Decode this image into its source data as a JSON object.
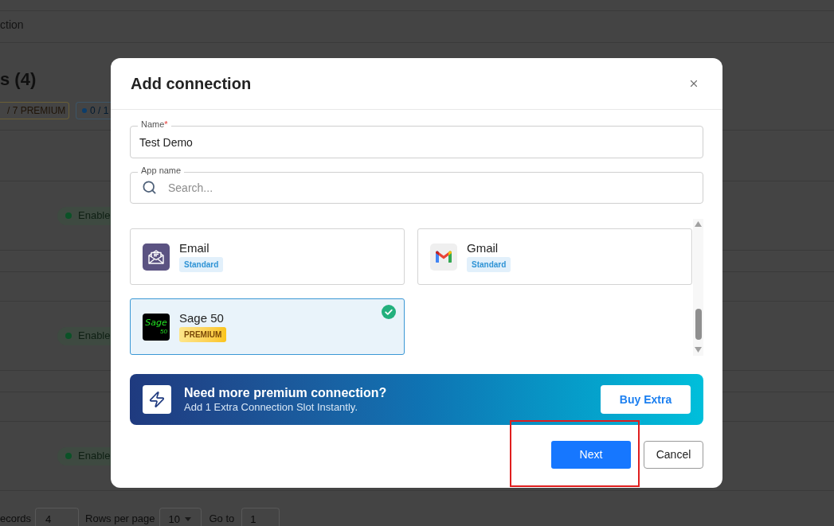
{
  "page": {
    "breadcrumb": "ction",
    "title": "s (4)",
    "badges": [
      {
        "kind": "premium",
        "text": "/ 7 PREMIUM"
      },
      {
        "kind": "count",
        "text": "0 / 1"
      }
    ],
    "rows": [
      {
        "status": "Enable"
      },
      {
        "status": "Enable"
      },
      {
        "status": "Enable"
      }
    ],
    "pagination": {
      "records_label": "ecords",
      "records": "4",
      "rows_per_page_label": "Rows per page",
      "rows_per_page": "10",
      "go_to_label": "Go to",
      "go_to": "1"
    }
  },
  "dialog": {
    "title": "Add connection",
    "fields": [
      {
        "kind": "text",
        "label": "Name",
        "required_mark": "*",
        "value": "Test Demo"
      },
      {
        "kind": "search",
        "label": "App name",
        "placeholder": "Search..."
      }
    ],
    "apps": [
      {
        "name": "Email",
        "tier": "Standard",
        "kind": "standard",
        "selected": false
      },
      {
        "name": "Gmail",
        "tier": "Standard",
        "kind": "standard",
        "selected": false
      },
      {
        "name": "Sage 50",
        "tier": "PREMIUM",
        "kind": "premium",
        "selected": true,
        "logo": {
          "text": "Sage",
          "subtext": "50"
        }
      }
    ],
    "banner": {
      "title": "Need more premium connection?",
      "subtitle": "Add 1 Extra Connection Slot Instantly.",
      "button": "Buy Extra"
    },
    "buttons": [
      {
        "label": "Next",
        "kind": "primary"
      },
      {
        "label": "Cancel",
        "kind": "secondary"
      }
    ]
  }
}
